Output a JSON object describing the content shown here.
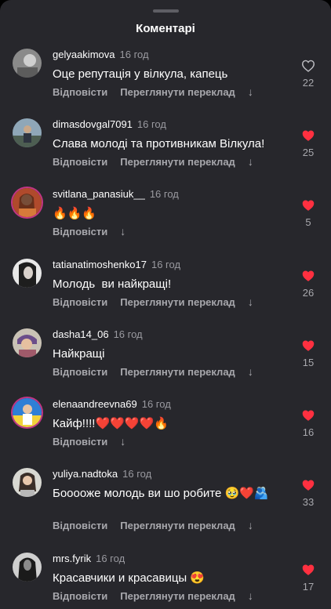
{
  "header": {
    "title": "Коментарі"
  },
  "actions": {
    "reply": "Відповісти",
    "translate": "Переглянути переклад",
    "arrow": "↓"
  },
  "colors": {
    "liked": "#ff3040",
    "background": "#27272c"
  },
  "comments": [
    {
      "user": "gelyaakimova",
      "time": "16 год",
      "text": "Оце репутація у вілкула, капець",
      "likes": "22",
      "liked": false,
      "translate": true
    },
    {
      "user": "dimasdovgal7091",
      "time": "16 год",
      "text": "Слава молоді та противникам Вілкула!",
      "likes": "25",
      "liked": true,
      "translate": true
    },
    {
      "user": "svitlana_panasiuk__",
      "time": "16 год",
      "text": "🔥🔥🔥",
      "likes": "5",
      "liked": true,
      "translate": false
    },
    {
      "user": "tatianatimoshenko17",
      "time": "16 год",
      "text": "Молодь  ви найкращі!",
      "likes": "26",
      "liked": true,
      "translate": true
    },
    {
      "user": "dasha14_06",
      "time": "16 год",
      "text": "Найкращі",
      "likes": "15",
      "liked": true,
      "translate": true
    },
    {
      "user": "elenaandreevna69",
      "time": "16 год",
      "text": "Кайф!!!!❤️❤️❤️❤️🔥",
      "likes": "16",
      "liked": true,
      "translate": false
    },
    {
      "user": "yuliya.nadtoka",
      "time": "16 год",
      "text": "Бооооже молодь ви шо робите 🥹❤️🫂",
      "likes": "33",
      "liked": true,
      "translate": true
    },
    {
      "user": "mrs.fyrik",
      "time": "16 год",
      "text": "Красавчики и красавицы 😍",
      "likes": "17",
      "liked": true,
      "translate": true
    }
  ]
}
